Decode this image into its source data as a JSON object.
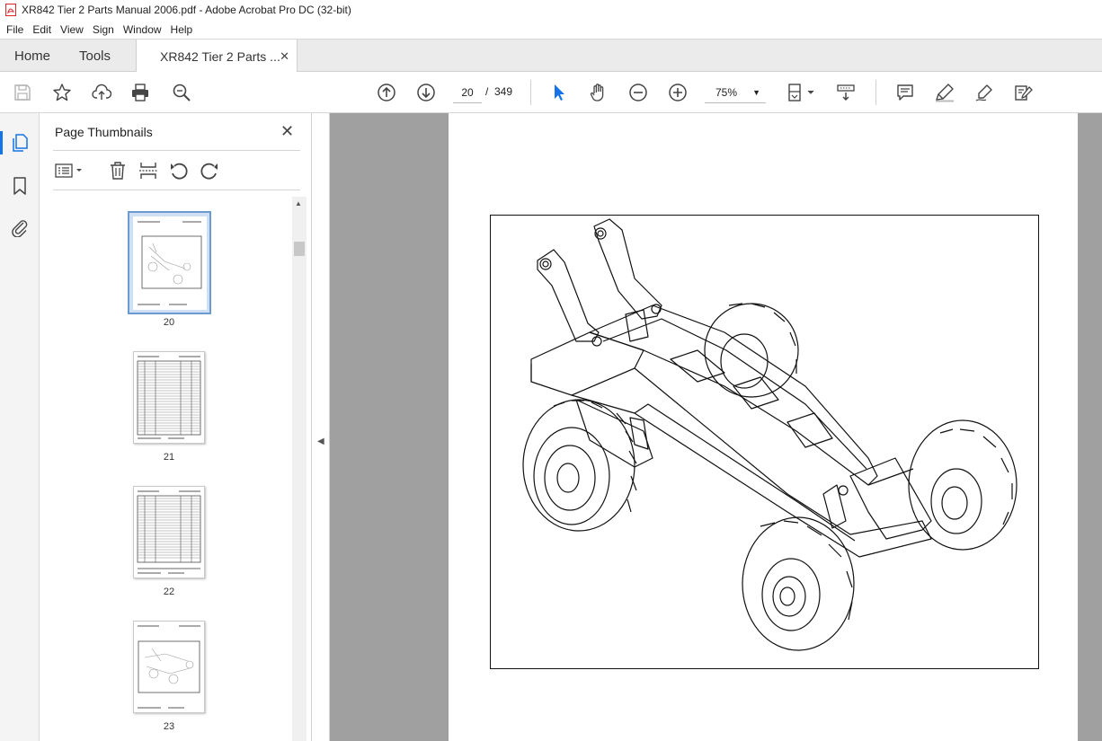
{
  "window": {
    "title": "XR842 Tier 2 Parts Manual 2006.pdf - Adobe Acrobat Pro DC (32-bit)",
    "icon": "acrobat-pdf-icon"
  },
  "menu": [
    "File",
    "Edit",
    "View",
    "Sign",
    "Window",
    "Help"
  ],
  "tabs": {
    "home": "Home",
    "tools": "Tools",
    "document": "XR842 Tier 2 Parts ...",
    "close_glyph": "✕"
  },
  "toolbar": {
    "current_page": "20",
    "page_separator": "/",
    "total_pages": "349",
    "zoom": "75%",
    "icons_left": [
      "save-icon",
      "bookmark-star-icon",
      "upload-icon",
      "print-icon",
      "zoom-search-icon"
    ],
    "icons_nav": [
      "page-up-icon",
      "page-down-icon"
    ],
    "icons_tools": [
      "select-cursor-icon",
      "hand-icon",
      "zoom-out-icon",
      "zoom-in-icon"
    ],
    "icons_right": [
      "page-fit-icon",
      "scroll-mode-icon",
      "comment-icon",
      "highlight-icon",
      "draw-icon",
      "fill-sign-icon"
    ]
  },
  "left_rail": [
    "page-thumbnails-icon",
    "bookmarks-icon",
    "attachments-icon"
  ],
  "thumbnail_panel": {
    "title": "Page Thumbnails",
    "close_glyph": "✕",
    "tools": [
      "thumbnail-options-icon",
      "delete-page-icon",
      "insert-page-icon",
      "rotate-ccw-icon",
      "rotate-cw-icon"
    ],
    "pages": [
      {
        "label": "20",
        "kind": "drawing",
        "selected": true
      },
      {
        "label": "21",
        "kind": "parts-list",
        "selected": false
      },
      {
        "label": "22",
        "kind": "parts-list",
        "selected": false
      },
      {
        "label": "23",
        "kind": "drawing",
        "selected": false
      }
    ]
  },
  "colors": {
    "accent": "#1473e6",
    "doc_background": "#a0a0a0",
    "selected_thumb": "#cfe0f4"
  }
}
